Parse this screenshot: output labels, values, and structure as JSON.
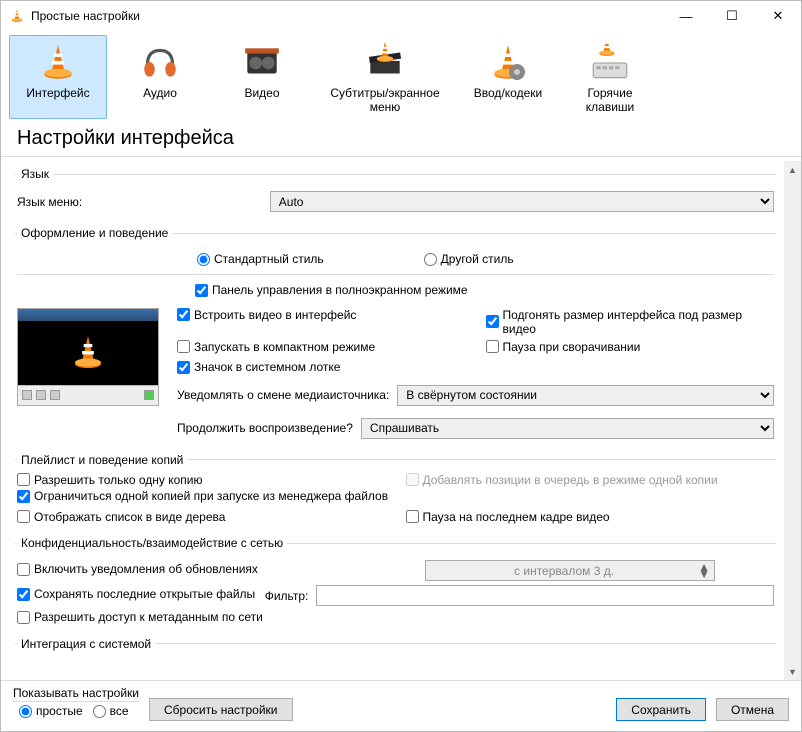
{
  "window": {
    "title": "Простые настройки"
  },
  "tabs": {
    "interface": "Интерфейс",
    "audio": "Аудио",
    "video": "Видео",
    "subtitles": "Субтитры/экранное меню",
    "input": "Ввод/кодеки",
    "hotkeys": "Горячие клавиши"
  },
  "heading": "Настройки интерфейса",
  "lang": {
    "group": "Язык",
    "label": "Язык меню:",
    "value": "Auto"
  },
  "look": {
    "group": "Оформление и поведение",
    "style_native": "Стандартный стиль",
    "style_custom": "Другой стиль",
    "fs_controller": "Панель управления в полноэкранном режиме",
    "embed_video": "Встроить видео в интерфейс",
    "resize_interface": "Подгонять размер интерфейса под размер видео",
    "minimal_view": "Запускать в компактном режиме",
    "pause_minimize": "Пауза при сворачивании",
    "systray": "Значок в системном лотке",
    "notify_label": "Уведомлять о смене медиаисточника:",
    "notify_value": "В свёрнутом состоянии",
    "continue_label": "Продолжить воспроизведение?",
    "continue_value": "Спрашивать"
  },
  "playlist": {
    "group": "Плейлист и поведение копий",
    "one_instance": "Разрешить только одну копию",
    "enqueue": "Добавлять позиции в очередь в режиме одной копии",
    "one_from_file": "Ограничиться одной копией при запуске из менеджера файлов",
    "tree": "Отображать список в виде дерева",
    "pause_last_frame": "Пауза на последнем кадре видео"
  },
  "privacy": {
    "group": "Конфиденциальность/взаимодействие с сетью",
    "updates": "Включить уведомления об обновлениях",
    "interval": "с интервалом 3 д.",
    "save_recent": "Сохранять последние открытые файлы",
    "filter_label": "Фильтр:",
    "metadata": "Разрешить доступ к метаданным по сети"
  },
  "os": {
    "group": "Интеграция с системой"
  },
  "footer": {
    "show_settings": "Показывать настройки",
    "simple": "простые",
    "all": "все",
    "reset": "Сбросить настройки",
    "save": "Сохранить",
    "cancel": "Отмена"
  }
}
